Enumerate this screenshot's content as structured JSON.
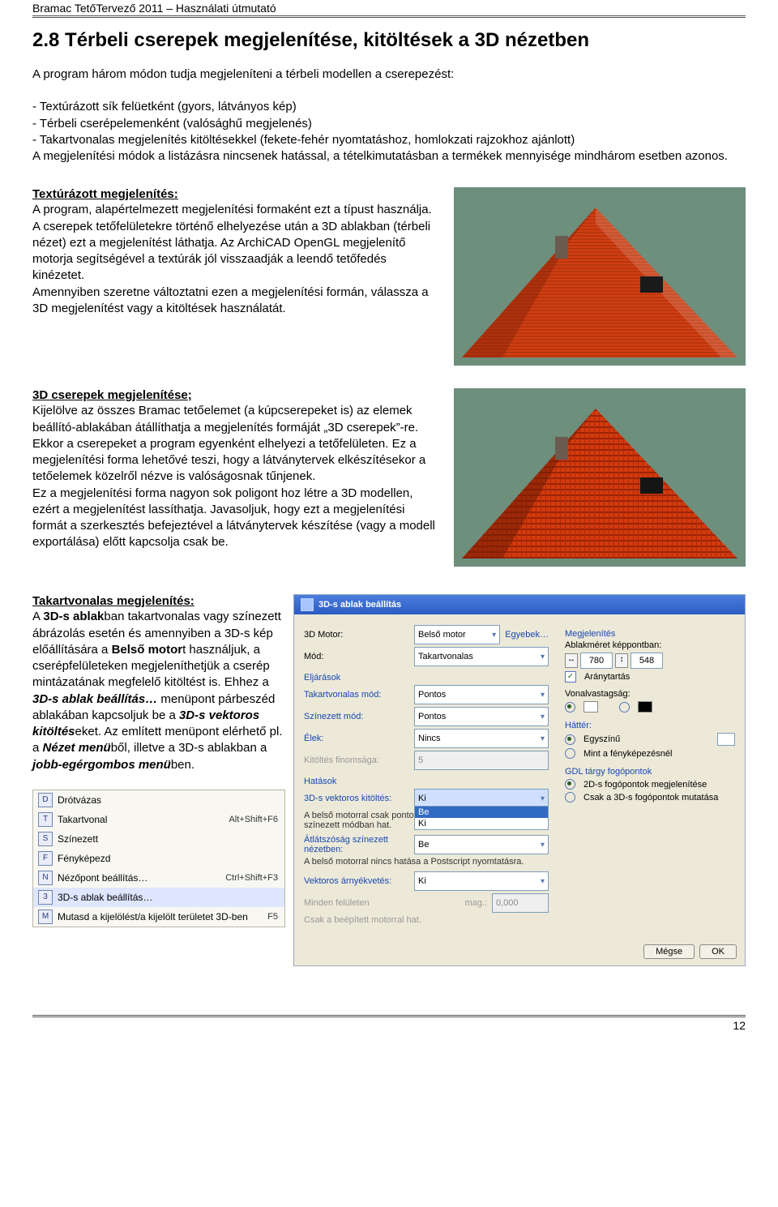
{
  "header": "Bramac TetőTervező 2011 – Használati útmutató",
  "heading": "2.8 Térbeli cserepek megjelenítése, kitöltések a 3D nézetben",
  "intro1": "A program három módon tudja megjeleníteni a térbeli modellen a cserepezést:",
  "bullet1": "- Textúrázott sík felüetként (gyors, látványos kép)",
  "bullet2": "- Térbeli cserépelemenként (valósághű megjelenés)",
  "bullet3": "- Takartvonalas megjelenítés kitöltésekkel (fekete-fehér nyomtatáshoz, homlokzati rajzokhoz ajánlott)",
  "intro2": "A megjelenítési módok a listázásra nincsenek hatással, a tételkimutatásban a termékek mennyisége mindhárom esetben azonos.",
  "b1_title": "Textúrázott megjelenítés:",
  "b1_text": "A program, alapértelmezett megjelenítési formaként ezt a típust használja. A cserepek tetőfelületekre történő elhelyezése után a 3D ablakban (térbeli nézet) ezt a megjelenítést láthatja. Az ArchiCAD OpenGL megjelenítő motorja segítségével a textúrák jól visszaadják a leendő tetőfedés kinézetet.\nAmennyiben szeretne változtatni ezen a megjelenítési formán, válassza a 3D megjelenítést vagy a kitöltések használatát.",
  "b2_title": "3D cserepek megjelenítése;",
  "b2_text": "Kijelölve az összes Bramac tetőelemet (a kúpcserepeket is) az elemek beállító-ablakában átállíthatja a megjelenítés formáját „3D cserepek”-re. Ekkor a cserepeket a program egyenként elhelyezi a tetőfelületen. Ez a megjelenítési forma lehetővé teszi, hogy a látványtervek elkészítésekor a tetőelemek közelről nézve is valóságosnak tűnjenek.\nEz a megjelenítési forma nagyon sok poligont hoz létre a 3D modellen, ezért a megjelenítést lassíthatja. Javasoljuk, hogy ezt a megjelenítési formát a szerkesztés befejeztével a látványtervek készítése (vagy a modell exportálása) előtt kapcsolja csak be.",
  "b3_title": "Takartvonalas megjelenítés:",
  "b3_text1": "A ",
  "b3_bold1": "3D-s ablak",
  "b3_text2": "ban takartvonalas vagy színezett ábrázolás esetén és amennyiben a 3D-s kép előállítására a ",
  "b3_bold2": "Belső motor",
  "b3_text3": "t használjuk, a cserépfelületeken megjeleníthetjük a cserép mintázatának megfelelő kitöltést is. Ehhez a ",
  "b3_bold3": "3D-s ablak beállítás…",
  "b3_text4": " menüpont párbeszéd ablakában kapcsoljuk be a ",
  "b3_bold4": "3D-s vektoros kitöltés",
  "b3_text5": "eket. Az említett menüpont elérhető pl. a ",
  "b3_bold5": "Nézet menü",
  "b3_text6": "ből, illetve a 3D-s ablakban a ",
  "b3_bold6": "jobb-egérgombos menü",
  "b3_text7": "ben.",
  "menu": {
    "items": [
      {
        "icon": "D",
        "label": "Drótvázas",
        "short": ""
      },
      {
        "icon": "T",
        "label": "Takartvonal",
        "short": "Alt+Shift+F6"
      },
      {
        "icon": "S",
        "label": "Színezett",
        "short": ""
      },
      {
        "icon": "F",
        "label": "Fényképezd",
        "short": ""
      },
      {
        "icon": "N",
        "label": "Nézőpont beállítás…",
        "short": "Ctrl+Shift+F3"
      },
      {
        "icon": "3",
        "label": "3D-s ablak beállítás…",
        "short": ""
      },
      {
        "icon": "M",
        "label": "Mutasd a kijelölést/a kijelölt területet 3D-ben",
        "short": "F5"
      }
    ],
    "selected": 5
  },
  "dialog": {
    "title": "3D-s ablak beállítás",
    "egyebek": "Egyebek…",
    "left": {
      "motor_l": "3D Motor:",
      "motor_v": "Belső motor",
      "mod_l": "Mód:",
      "mod_v": "Takartvonalas",
      "eljarasok": "Eljárások",
      "takart_l": "Takartvonalas mód:",
      "takart_v": "Pontos",
      "szin_l": "Színezett mód:",
      "szin_v": "Pontos",
      "elek_l": "Élek:",
      "elek_v": "Nincs",
      "finom_l": "Kitöltés finomsága:",
      "finom_v": "5",
      "hatasok": "Hatások",
      "vekt_l": "3D-s vektoros kitöltés:",
      "vekt_v": "Ki",
      "vekt_opt": "Be",
      "vekt_note": "A belső motorral csak pontos takartvonalas és pontos színezett módban hat.",
      "atl_l": "Átlátszóság színezett nézetben:",
      "atl_v": "Be",
      "atl_note": "A belső motorral nincs hatása a Postscript nyomtatásra.",
      "arny_l": "Vektoros árnyékvetés:",
      "arny_v": "Ki",
      "minden_l": "Minden felületen",
      "mag_l": "mag.:",
      "mag_v": "0,000",
      "csak": "Csak a beépített motorral hat."
    },
    "right": {
      "megj": "Megjelenítés",
      "abk": "Ablakméret képpontban:",
      "w": "780",
      "h": "548",
      "arany": "Aránytartás",
      "vonal": "Vonalvastagság:",
      "hatter": "Háttér:",
      "egyszinu": "Egyszínű",
      "mintfk": "Mint a fényképezésnél",
      "gdl": "GDL tárgy fogópontok",
      "gdl1": "2D-s fogópontok megjelenítése",
      "gdl2": "Csak a 3D-s fogópontok mutatása"
    },
    "cancel": "Mégse",
    "ok": "OK"
  },
  "pagenum": "12"
}
